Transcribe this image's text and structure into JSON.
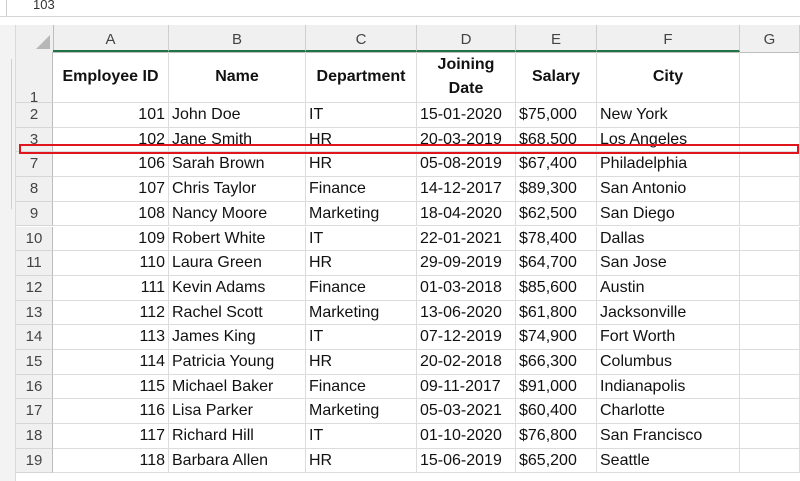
{
  "formula_bar": {
    "value": "103"
  },
  "column_headers": [
    "A",
    "B",
    "C",
    "D",
    "E",
    "F",
    "G"
  ],
  "header_row": {
    "row_number": "1",
    "cells": [
      "Employee ID",
      "Name",
      "Department",
      "Joining Date",
      "Salary",
      "City"
    ]
  },
  "rows": [
    {
      "row_number": "2",
      "cells": [
        "101",
        "John Doe",
        "IT",
        "15-01-2020",
        "$75,000",
        "New York"
      ]
    },
    {
      "row_number": "3",
      "cells": [
        "102",
        "Jane Smith",
        "HR",
        "20-03-2019",
        "$68,500",
        "Los Angeles"
      ]
    },
    {
      "row_number": "7",
      "cells": [
        "106",
        "Sarah Brown",
        "HR",
        "05-08-2019",
        "$67,400",
        "Philadelphia"
      ]
    },
    {
      "row_number": "8",
      "cells": [
        "107",
        "Chris Taylor",
        "Finance",
        "14-12-2017",
        "$89,300",
        "San Antonio"
      ]
    },
    {
      "row_number": "9",
      "cells": [
        "108",
        "Nancy Moore",
        "Marketing",
        "18-04-2020",
        "$62,500",
        "San Diego"
      ]
    },
    {
      "row_number": "10",
      "cells": [
        "109",
        "Robert White",
        "IT",
        "22-01-2021",
        "$78,400",
        "Dallas"
      ]
    },
    {
      "row_number": "11",
      "cells": [
        "110",
        "Laura Green",
        "HR",
        "29-09-2019",
        "$64,700",
        "San Jose"
      ]
    },
    {
      "row_number": "12",
      "cells": [
        "111",
        "Kevin Adams",
        "Finance",
        "01-03-2018",
        "$85,600",
        "Austin"
      ]
    },
    {
      "row_number": "13",
      "cells": [
        "112",
        "Rachel Scott",
        "Marketing",
        "13-06-2020",
        "$61,800",
        "Jacksonville"
      ]
    },
    {
      "row_number": "14",
      "cells": [
        "113",
        "James King",
        "IT",
        "07-12-2019",
        "$74,900",
        "Fort Worth"
      ]
    },
    {
      "row_number": "15",
      "cells": [
        "114",
        "Patricia Young",
        "HR",
        "20-02-2018",
        "$66,300",
        "Columbus"
      ]
    },
    {
      "row_number": "16",
      "cells": [
        "115",
        "Michael Baker",
        "Finance",
        "09-11-2017",
        "$91,000",
        "Indianapolis"
      ]
    },
    {
      "row_number": "17",
      "cells": [
        "116",
        "Lisa Parker",
        "Marketing",
        "05-03-2021",
        "$60,400",
        "Charlotte"
      ]
    },
    {
      "row_number": "18",
      "cells": [
        "117",
        "Richard Hill",
        "IT",
        "01-10-2020",
        "$76,800",
        "San Francisco"
      ]
    },
    {
      "row_number": "19",
      "cells": [
        "118",
        "Barbara Allen",
        "HR",
        "15-06-2019",
        "$65,200",
        "Seattle"
      ]
    }
  ],
  "colors": {
    "highlight": "#e0141b",
    "selected_column_border": "#217346",
    "header_bg": "#f0f0f0"
  }
}
